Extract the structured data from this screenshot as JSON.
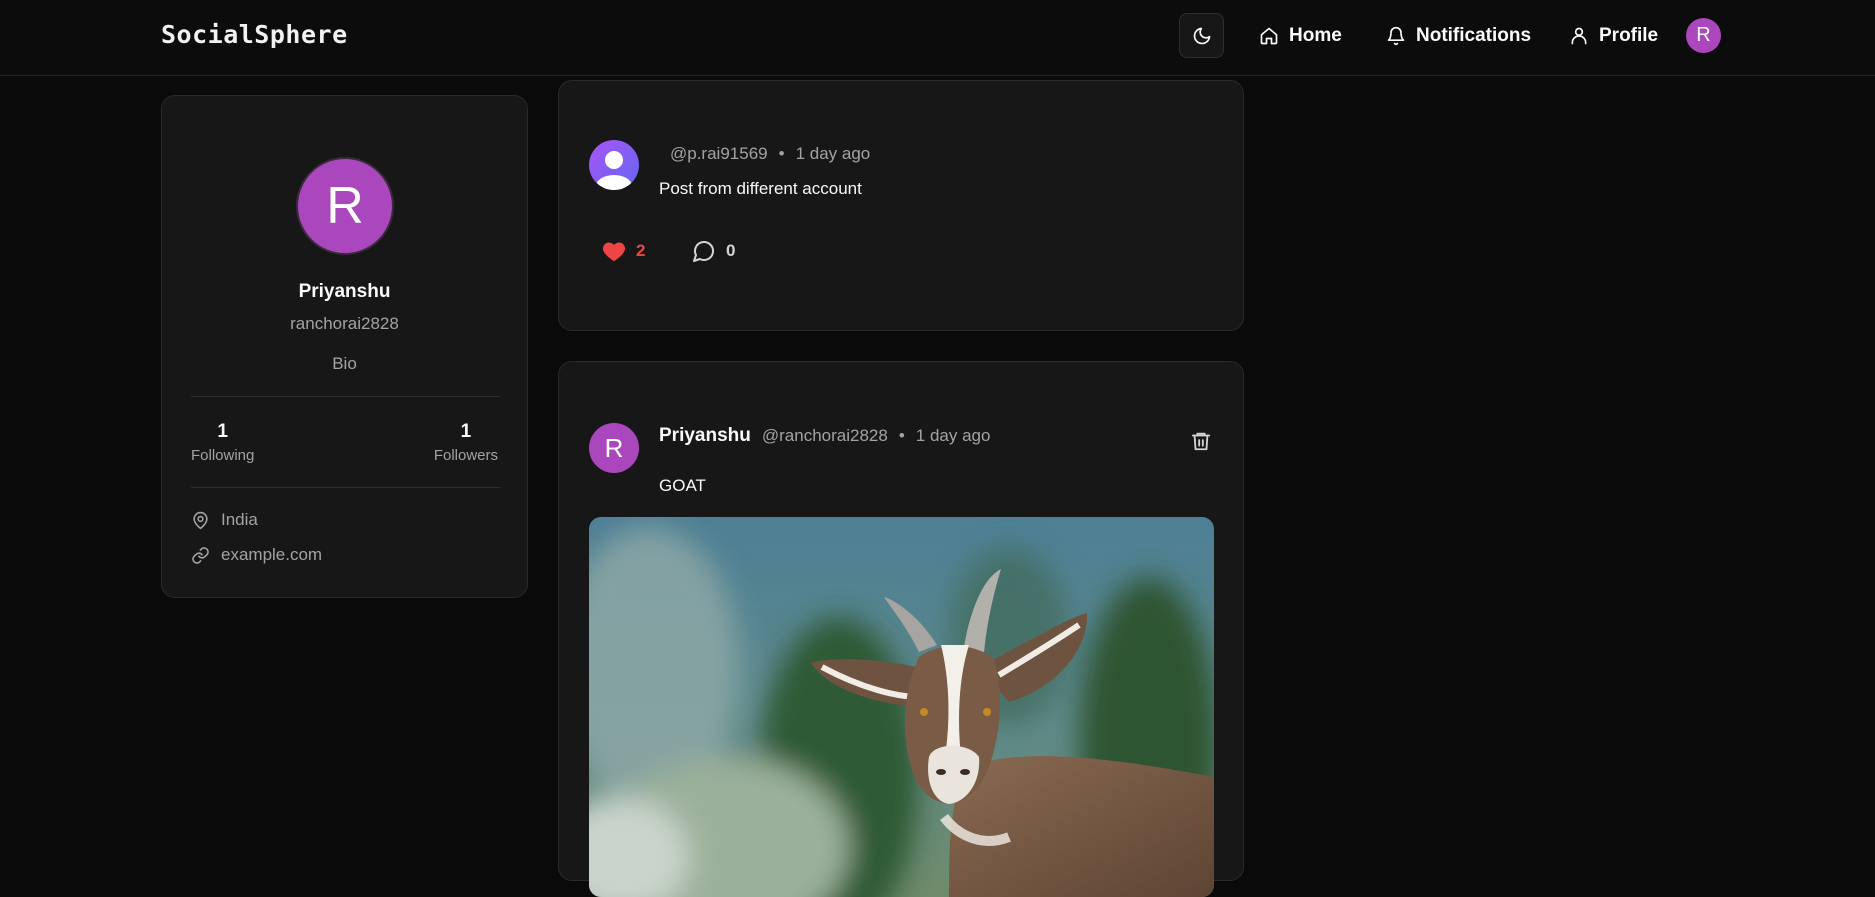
{
  "app": {
    "brand": "SocialSphere"
  },
  "nav": {
    "theme_icon": "moon-icon",
    "items": [
      {
        "label": "Home",
        "icon": "home-icon"
      },
      {
        "label": "Notifications",
        "icon": "bell-icon"
      },
      {
        "label": "Profile",
        "icon": "user-icon"
      }
    ],
    "avatar_initial": "R"
  },
  "profile": {
    "initial": "R",
    "name": "Priyanshu",
    "username": "ranchorai2828",
    "bio": "Bio",
    "following_count": "1",
    "following_label": "Following",
    "followers_count": "1",
    "followers_label": "Followers",
    "location": "India",
    "website": "example.com"
  },
  "posts": [
    {
      "author": "",
      "handle": "@p.rai91569",
      "separator": "•",
      "time": "1 day ago",
      "text": "Post from different account",
      "likes": "2",
      "liked": true,
      "comments": "0"
    },
    {
      "author": "Priyanshu",
      "avatar_initial": "R",
      "handle": "@ranchorai2828",
      "separator": "•",
      "time": "1 day ago",
      "text": "GOAT",
      "image": "goat photo"
    }
  ],
  "colors": {
    "background": "#0a0a0a",
    "card": "#171717",
    "avatar_purple": "#ab47bc",
    "like_red": "#ef4444",
    "muted_text": "#a3a3a3"
  }
}
